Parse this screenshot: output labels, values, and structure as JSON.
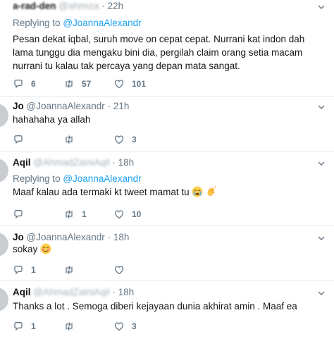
{
  "tweets": [
    {
      "name": "a-rad-den",
      "handle": "@ahmiza",
      "time": "22h",
      "reply_label": "Replying to",
      "reply_to": "@JoannaAlexandr",
      "text": "Pesan dekat iqbal, suruh move on cepat cepat. Nurrani kat indon dah lama tunggu dia mengaku bini dia, pergilah claim orang setia macam nurrani tu kalau tak percaya yang depan mata sangat.",
      "replies": "6",
      "retweets": "57",
      "likes": "101"
    },
    {
      "name": "Jo",
      "handle": "@JoannaAlexandr",
      "time": "21h",
      "text": "hahahaha ya allah",
      "replies": "",
      "retweets": "",
      "likes": "3"
    },
    {
      "name": "Aqil",
      "handle": "@AhmadZainiAqil",
      "time": "18h",
      "reply_label": "Replying to",
      "reply_to": "@JoannaAlexandr",
      "text": "Maaf kalau ada termaki kt tweet mamat tu",
      "emojis": [
        "crying-face-emoji",
        "clapping-hands-emoji"
      ],
      "replies": "",
      "retweets": "1",
      "likes": "10"
    },
    {
      "name": "Jo",
      "handle": "@JoannaAlexandr",
      "time": "18h",
      "text": "sokay",
      "emojis": [
        "smiling-blush-emoji"
      ],
      "replies": "1",
      "retweets": "",
      "likes": ""
    },
    {
      "name": "Aqil",
      "handle": "@AhmadZainiAqil",
      "time": "18h",
      "text": "Thanks a lot . Semoga diberi kejayaan dunia akhirat amin . Maaf ea",
      "replies": "1",
      "retweets": "",
      "likes": "3"
    }
  ],
  "separator": "·",
  "colors": {
    "accent": "#1da1f2",
    "muted": "#657786",
    "text": "#14171a",
    "divider": "#e6ecf0"
  },
  "icons": [
    "reply-icon",
    "retweet-icon",
    "like-icon",
    "chevron-down-icon"
  ]
}
